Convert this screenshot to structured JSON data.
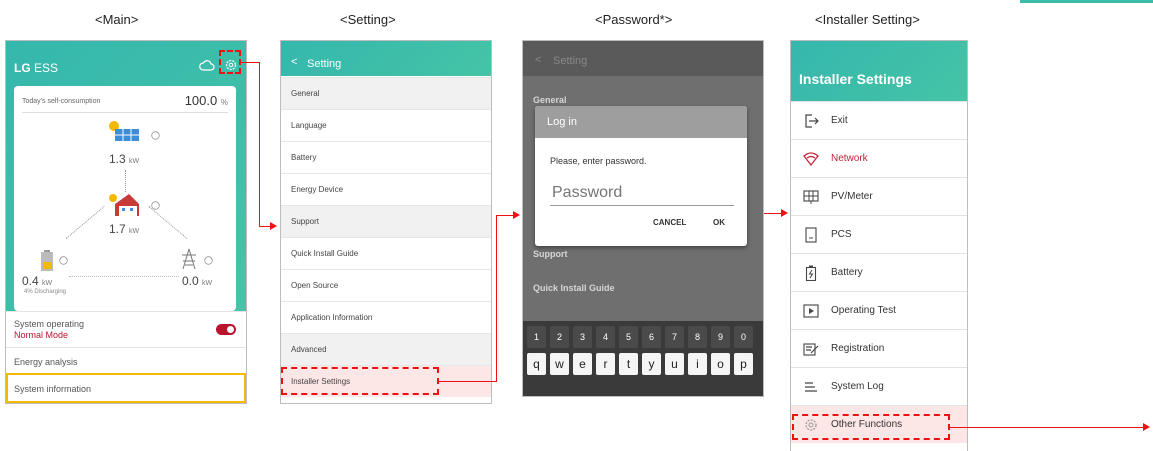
{
  "captions": {
    "main": "<Main>",
    "setting": "<Setting>",
    "password": "<Password*>",
    "installer": "<Installer Setting>"
  },
  "main": {
    "brand_bold": "LG",
    "brand_rest": " ESS",
    "self_consumption_label": "Today's self-consumption",
    "self_consumption_value": "100.0",
    "self_consumption_unit": "%",
    "pv_value": "1.3",
    "home_value": "1.7",
    "battery_value": "0.4",
    "grid_value": "0.0",
    "unit": "kW",
    "battery_status": "4% Discharging",
    "system_operating": "System operating",
    "mode": "Normal Mode",
    "energy_analysis": "Energy analysis",
    "system_information": "System information"
  },
  "setting": {
    "title": "Setting",
    "back": "<",
    "items": [
      "General",
      "Language",
      "Battery",
      "Energy Device",
      "Support",
      "Quick Install Guide",
      "Open Source",
      "Application Information",
      "Advanced",
      "Installer Settings"
    ]
  },
  "password": {
    "bg_title": "Setting",
    "bg_general": "General",
    "bg_support": "Support",
    "bg_quick": "Quick Install Guide",
    "dialog_title": "Log in",
    "prompt": "Please, enter password.",
    "placeholder": "Password",
    "cancel": "CANCEL",
    "ok": "OK",
    "numbers": [
      "1",
      "2",
      "3",
      "4",
      "5",
      "6",
      "7",
      "8",
      "9",
      "0"
    ],
    "letters": [
      "q",
      "w",
      "e",
      "r",
      "t",
      "y",
      "u",
      "i",
      "o",
      "p"
    ]
  },
  "installer": {
    "title": "Installer Settings",
    "items": [
      "Exit",
      "Network",
      "PV/Meter",
      "PCS",
      "Battery",
      "Operating Test",
      "Registration",
      "System Log",
      "Other Functions"
    ]
  },
  "colors": {
    "teal": "#3bbcab",
    "highlight_red": "#e11111",
    "network_red": "#c0243a",
    "mode_red": "#b8142e",
    "yellow": "#f5b800"
  }
}
